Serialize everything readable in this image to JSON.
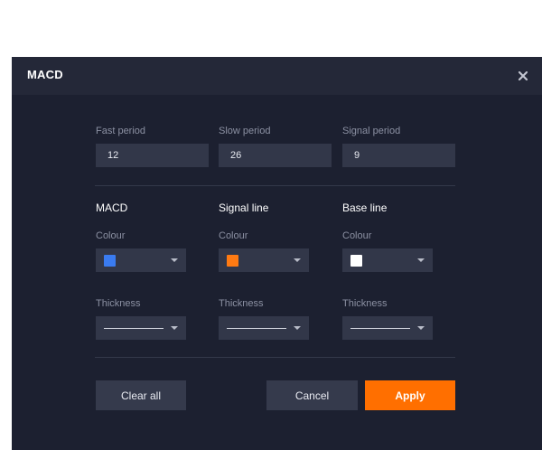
{
  "dialog": {
    "title": "MACD"
  },
  "periods": [
    {
      "label": "Fast period",
      "value": "12"
    },
    {
      "label": "Slow period",
      "value": "26"
    },
    {
      "label": "Signal period",
      "value": "9"
    }
  ],
  "lines": [
    {
      "title": "MACD",
      "colour_label": "Colour",
      "colour": "#3a7bf0",
      "thickness_label": "Thickness"
    },
    {
      "title": "Signal line",
      "colour_label": "Colour",
      "colour": "#ff7a12",
      "thickness_label": "Thickness"
    },
    {
      "title": "Base line",
      "colour_label": "Colour",
      "colour": "#ffffff",
      "thickness_label": "Thickness"
    }
  ],
  "icons": {
    "close": "close-icon",
    "dropdown": "chevron-down-icon"
  },
  "buttons": {
    "clear_all": "Clear all",
    "cancel": "Cancel",
    "apply": "Apply"
  },
  "theme": {
    "accent": "#ff6f00",
    "panel": "#1c2030",
    "input": "#323749"
  }
}
